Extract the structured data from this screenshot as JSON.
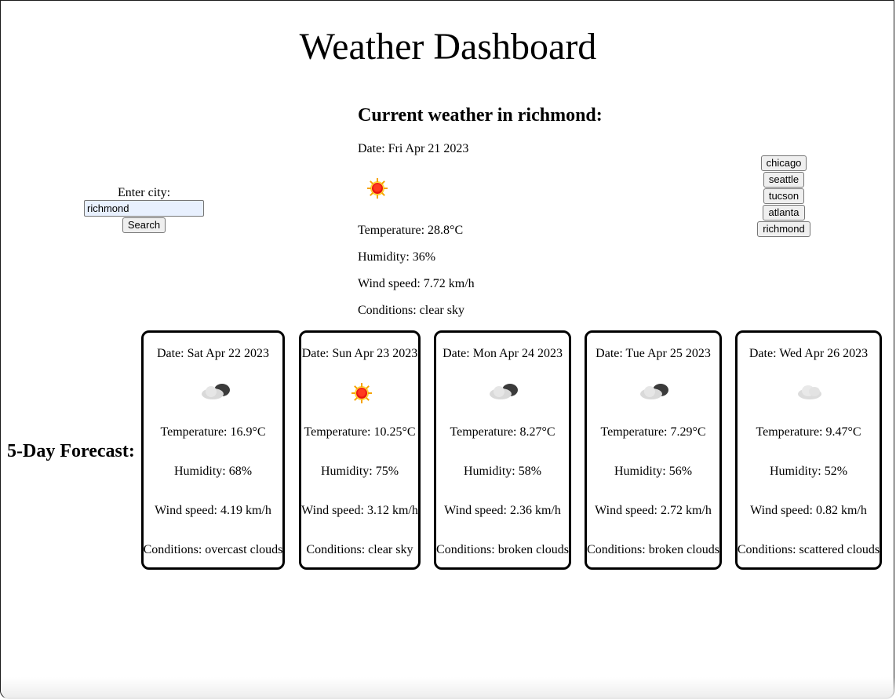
{
  "page": {
    "title": "Weather Dashboard"
  },
  "search": {
    "label": "Enter city:",
    "value": "richmond",
    "button_label": "Search"
  },
  "current": {
    "heading": "Current weather in richmond:",
    "date": "Date: Fri Apr 21 2023",
    "icon": "sun-icon",
    "temperature": "Temperature: 28.8°C",
    "humidity": "Humidity: 36%",
    "wind": "Wind speed: 7.72 km/h",
    "conditions": "Conditions: clear sky"
  },
  "history": [
    "chicago",
    "seattle",
    "tucson",
    "atlanta",
    "richmond"
  ],
  "forecast": {
    "label": "5-Day Forecast:",
    "days": [
      {
        "date": "Date: Sat Apr 22 2023",
        "icon": "overcast-clouds-icon",
        "temperature": "Temperature: 16.9°C",
        "humidity": "Humidity: 68%",
        "wind": "Wind speed: 4.19 km/h",
        "conditions": "Conditions: overcast clouds"
      },
      {
        "date": "Date: Sun Apr 23 2023",
        "icon": "sun-icon",
        "temperature": "Temperature: 10.25°C",
        "humidity": "Humidity: 75%",
        "wind": "Wind speed: 3.12 km/h",
        "conditions": "Conditions: clear sky"
      },
      {
        "date": "Date: Mon Apr 24 2023",
        "icon": "broken-clouds-icon",
        "temperature": "Temperature: 8.27°C",
        "humidity": "Humidity: 58%",
        "wind": "Wind speed: 2.36 km/h",
        "conditions": "Conditions: broken clouds"
      },
      {
        "date": "Date: Tue Apr 25 2023",
        "icon": "broken-clouds-icon",
        "temperature": "Temperature: 7.29°C",
        "humidity": "Humidity: 56%",
        "wind": "Wind speed: 2.72 km/h",
        "conditions": "Conditions: broken clouds"
      },
      {
        "date": "Date: Wed Apr 26 2023",
        "icon": "scattered-clouds-icon",
        "temperature": "Temperature: 9.47°C",
        "humidity": "Humidity: 52%",
        "wind": "Wind speed: 0.82 km/h",
        "conditions": "Conditions: scattered clouds"
      }
    ]
  }
}
